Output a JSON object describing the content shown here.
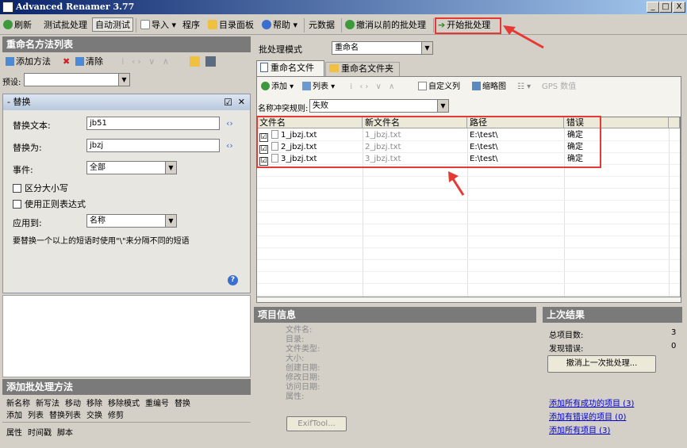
{
  "window": {
    "title": "Advanced Renamer 3.77",
    "min": "_",
    "max": "□",
    "close": "X"
  },
  "toolbar": {
    "refresh": "刷新",
    "test_batch": "测试批处理",
    "auto_test": "自动测试",
    "import": "导入",
    "program": "程序",
    "dir_panel": "目录面板",
    "help": "帮助",
    "metadata": "元数据",
    "undo_prev": "撤消以前的批处理",
    "start_batch": "开始批处理"
  },
  "left": {
    "methods_title": "重命名方法列表",
    "add_method": "添加方法",
    "clear": "清除",
    "preset_label": "预设:",
    "preset_value": "",
    "method": {
      "title": "替换",
      "checked": "☑",
      "close": "✕",
      "replace_text_label": "替换文本:",
      "replace_text_value": "jb51",
      "replace_with_label": "替换为:",
      "replace_with_value": "jbzj",
      "occurrence_label": "事件:",
      "occurrence_value": "全部",
      "case_sensitive": "区分大小写",
      "use_regex": "使用正则表达式",
      "apply_to_label": "应用到:",
      "apply_to_value": "名称",
      "hint": "要替换一个以上的短语时使用\"\\\"来分隔不同的短语",
      "help": "?"
    },
    "add_batch_title": "添加批处理方法",
    "methods_row1": [
      "新名称",
      "新写法",
      "移动",
      "移除",
      "移除模式",
      "重编号",
      "替换"
    ],
    "methods_row2": [
      "添加",
      "列表",
      "替换列表",
      "交换",
      "修剪"
    ],
    "methods_row3": [
      "属性",
      "时间戳",
      "脚本"
    ]
  },
  "right": {
    "batch_mode_label": "批处理模式",
    "batch_mode_value": "重命名",
    "tabs": [
      "重命名文件",
      "重命名文件夹"
    ],
    "sub_toolbar": {
      "add": "添加",
      "list": "列表",
      "custom_columns": "自定义列",
      "thumbnails": "缩略图",
      "gps": "GPS 数值"
    },
    "conflict_label": "名称冲突规则:",
    "conflict_value": "失败",
    "columns": [
      "文件名",
      "新文件名",
      "路径",
      "错误"
    ],
    "rows": [
      {
        "checked": "☑",
        "name": "1_jbzj.txt",
        "new_name": "1_jbzj.txt",
        "path": "E:\\test\\",
        "error": "确定"
      },
      {
        "checked": "☑",
        "name": "2_jbzj.txt",
        "new_name": "2_jbzj.txt",
        "path": "E:\\test\\",
        "error": "确定"
      },
      {
        "checked": "☑",
        "name": "3_jbzj.txt",
        "new_name": "3_jbzj.txt",
        "path": "E:\\test\\",
        "error": "确定"
      }
    ],
    "item_info": {
      "title": "项目信息",
      "fields": [
        "文件名:",
        "目录:",
        "文件类型:",
        "大小:",
        "创建日期:",
        "修改日期:",
        "访问日期:",
        "属性:"
      ],
      "exiftool": "ExifTool..."
    },
    "last_result": {
      "title": "上次结果",
      "total_label": "总项目数:",
      "total_value": "3",
      "errors_label": "发现错误:",
      "errors_value": "0",
      "undo_last": "撤消上一次批处理...",
      "link_success": "添加所有成功的项目 (3)",
      "link_errors": "添加有错误的项目 (0)",
      "link_all": "添加所有项目 (3)"
    }
  },
  "colors": {
    "highlight": "#e53935",
    "title_bar": "#0a246a",
    "panel_header": "#7a7a7a",
    "method_header": "#c6d3e8"
  }
}
